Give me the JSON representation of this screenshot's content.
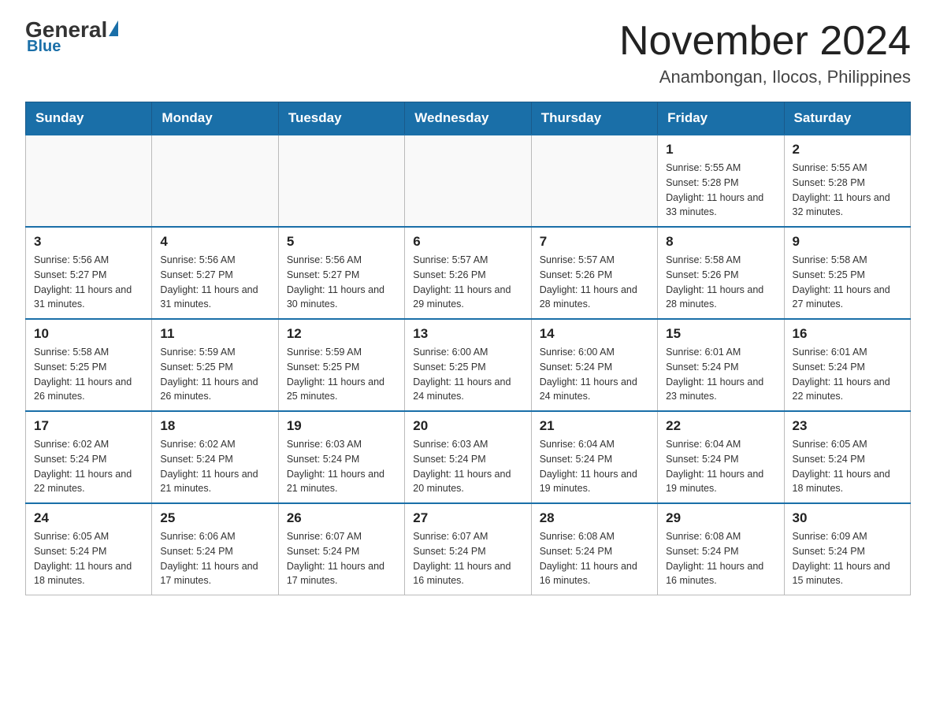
{
  "header": {
    "logo_general": "General",
    "logo_triangle": "▶",
    "logo_blue": "Blue",
    "main_title": "November 2024",
    "subtitle": "Anambongan, Ilocos, Philippines"
  },
  "days_of_week": [
    "Sunday",
    "Monday",
    "Tuesday",
    "Wednesday",
    "Thursday",
    "Friday",
    "Saturday"
  ],
  "weeks": [
    [
      {
        "day": "",
        "info": ""
      },
      {
        "day": "",
        "info": ""
      },
      {
        "day": "",
        "info": ""
      },
      {
        "day": "",
        "info": ""
      },
      {
        "day": "",
        "info": ""
      },
      {
        "day": "1",
        "info": "Sunrise: 5:55 AM\nSunset: 5:28 PM\nDaylight: 11 hours and 33 minutes."
      },
      {
        "day": "2",
        "info": "Sunrise: 5:55 AM\nSunset: 5:28 PM\nDaylight: 11 hours and 32 minutes."
      }
    ],
    [
      {
        "day": "3",
        "info": "Sunrise: 5:56 AM\nSunset: 5:27 PM\nDaylight: 11 hours and 31 minutes."
      },
      {
        "day": "4",
        "info": "Sunrise: 5:56 AM\nSunset: 5:27 PM\nDaylight: 11 hours and 31 minutes."
      },
      {
        "day": "5",
        "info": "Sunrise: 5:56 AM\nSunset: 5:27 PM\nDaylight: 11 hours and 30 minutes."
      },
      {
        "day": "6",
        "info": "Sunrise: 5:57 AM\nSunset: 5:26 PM\nDaylight: 11 hours and 29 minutes."
      },
      {
        "day": "7",
        "info": "Sunrise: 5:57 AM\nSunset: 5:26 PM\nDaylight: 11 hours and 28 minutes."
      },
      {
        "day": "8",
        "info": "Sunrise: 5:58 AM\nSunset: 5:26 PM\nDaylight: 11 hours and 28 minutes."
      },
      {
        "day": "9",
        "info": "Sunrise: 5:58 AM\nSunset: 5:25 PM\nDaylight: 11 hours and 27 minutes."
      }
    ],
    [
      {
        "day": "10",
        "info": "Sunrise: 5:58 AM\nSunset: 5:25 PM\nDaylight: 11 hours and 26 minutes."
      },
      {
        "day": "11",
        "info": "Sunrise: 5:59 AM\nSunset: 5:25 PM\nDaylight: 11 hours and 26 minutes."
      },
      {
        "day": "12",
        "info": "Sunrise: 5:59 AM\nSunset: 5:25 PM\nDaylight: 11 hours and 25 minutes."
      },
      {
        "day": "13",
        "info": "Sunrise: 6:00 AM\nSunset: 5:25 PM\nDaylight: 11 hours and 24 minutes."
      },
      {
        "day": "14",
        "info": "Sunrise: 6:00 AM\nSunset: 5:24 PM\nDaylight: 11 hours and 24 minutes."
      },
      {
        "day": "15",
        "info": "Sunrise: 6:01 AM\nSunset: 5:24 PM\nDaylight: 11 hours and 23 minutes."
      },
      {
        "day": "16",
        "info": "Sunrise: 6:01 AM\nSunset: 5:24 PM\nDaylight: 11 hours and 22 minutes."
      }
    ],
    [
      {
        "day": "17",
        "info": "Sunrise: 6:02 AM\nSunset: 5:24 PM\nDaylight: 11 hours and 22 minutes."
      },
      {
        "day": "18",
        "info": "Sunrise: 6:02 AM\nSunset: 5:24 PM\nDaylight: 11 hours and 21 minutes."
      },
      {
        "day": "19",
        "info": "Sunrise: 6:03 AM\nSunset: 5:24 PM\nDaylight: 11 hours and 21 minutes."
      },
      {
        "day": "20",
        "info": "Sunrise: 6:03 AM\nSunset: 5:24 PM\nDaylight: 11 hours and 20 minutes."
      },
      {
        "day": "21",
        "info": "Sunrise: 6:04 AM\nSunset: 5:24 PM\nDaylight: 11 hours and 19 minutes."
      },
      {
        "day": "22",
        "info": "Sunrise: 6:04 AM\nSunset: 5:24 PM\nDaylight: 11 hours and 19 minutes."
      },
      {
        "day": "23",
        "info": "Sunrise: 6:05 AM\nSunset: 5:24 PM\nDaylight: 11 hours and 18 minutes."
      }
    ],
    [
      {
        "day": "24",
        "info": "Sunrise: 6:05 AM\nSunset: 5:24 PM\nDaylight: 11 hours and 18 minutes."
      },
      {
        "day": "25",
        "info": "Sunrise: 6:06 AM\nSunset: 5:24 PM\nDaylight: 11 hours and 17 minutes."
      },
      {
        "day": "26",
        "info": "Sunrise: 6:07 AM\nSunset: 5:24 PM\nDaylight: 11 hours and 17 minutes."
      },
      {
        "day": "27",
        "info": "Sunrise: 6:07 AM\nSunset: 5:24 PM\nDaylight: 11 hours and 16 minutes."
      },
      {
        "day": "28",
        "info": "Sunrise: 6:08 AM\nSunset: 5:24 PM\nDaylight: 11 hours and 16 minutes."
      },
      {
        "day": "29",
        "info": "Sunrise: 6:08 AM\nSunset: 5:24 PM\nDaylight: 11 hours and 16 minutes."
      },
      {
        "day": "30",
        "info": "Sunrise: 6:09 AM\nSunset: 5:24 PM\nDaylight: 11 hours and 15 minutes."
      }
    ]
  ]
}
